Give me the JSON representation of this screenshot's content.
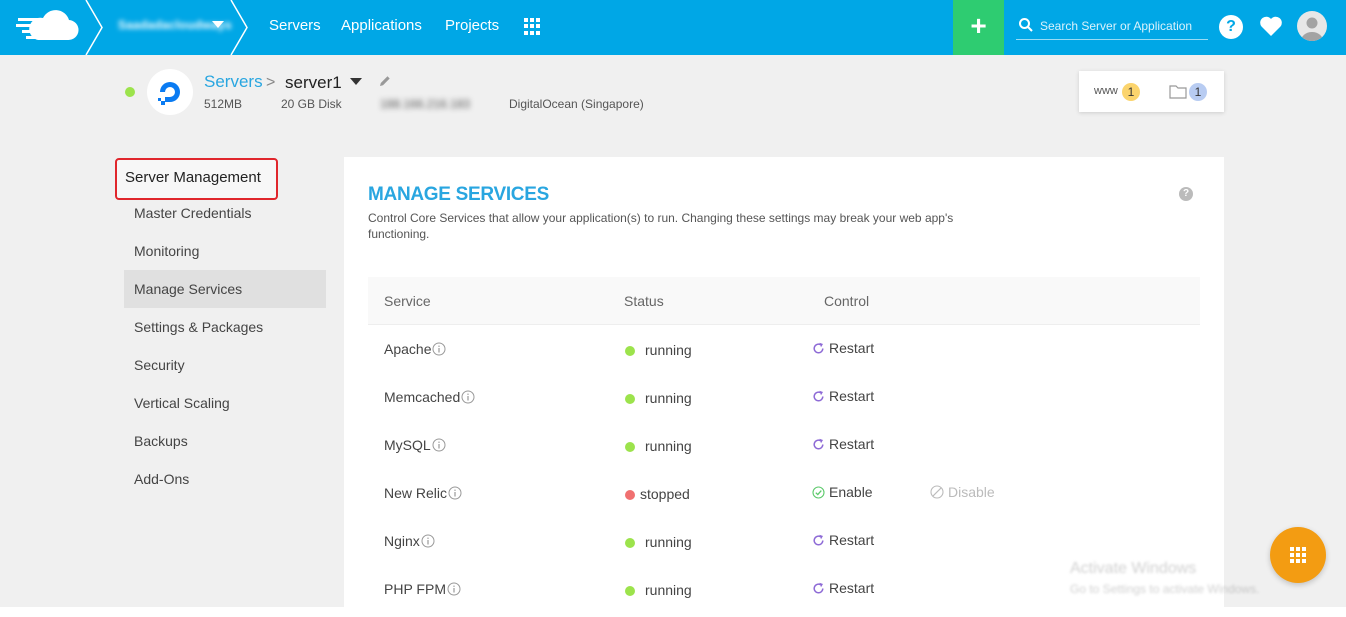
{
  "topbar": {
    "team_name": "Saadadacloudways",
    "nav": [
      "Servers",
      "Applications",
      "Projects"
    ],
    "add_label": "+",
    "search_placeholder": "Search Server or Application",
    "help_label": "?",
    "brand_color": "#00a7e6",
    "add_color": "#2ecc71"
  },
  "server": {
    "breadcrumb_root": "Servers",
    "breadcrumb_sep": ">",
    "name": "server1",
    "ram": "512MB",
    "disk": "20 GB Disk",
    "ip": "188.166.216.183",
    "location": "DigitalOcean (Singapore)",
    "status_color": "#9ce34c",
    "www_label": "www",
    "www_count": "1",
    "folder_count": "1"
  },
  "sidebar": {
    "title": "Server Management",
    "items": [
      {
        "label": "Master Credentials",
        "active": false
      },
      {
        "label": "Monitoring",
        "active": false
      },
      {
        "label": "Manage Services",
        "active": true
      },
      {
        "label": "Settings & Packages",
        "active": false
      },
      {
        "label": "Security",
        "active": false
      },
      {
        "label": "Vertical Scaling",
        "active": false
      },
      {
        "label": "Backups",
        "active": false
      },
      {
        "label": "Add-Ons",
        "active": false
      }
    ]
  },
  "main": {
    "title": "MANAGE SERVICES",
    "description": "Control Core Services that allow your application(s) to run. Changing these settings may break your web app's functioning.",
    "help_label": "?",
    "columns": [
      "Service",
      "Status",
      "Control"
    ],
    "rows": [
      {
        "service": "Apache",
        "status": "running",
        "control": "Restart"
      },
      {
        "service": "Memcached",
        "status": "running",
        "control": "Restart"
      },
      {
        "service": "MySQL",
        "status": "running",
        "control": "Restart"
      },
      {
        "service": "New Relic",
        "status": "stopped",
        "control": "Enable",
        "control2": "Disable"
      },
      {
        "service": "Nginx",
        "status": "running",
        "control": "Restart"
      },
      {
        "service": "PHP FPM",
        "status": "running",
        "control": "Restart"
      }
    ]
  },
  "watermark": {
    "line1": "Activate Windows",
    "line2": "Go to Settings to activate Windows."
  },
  "colors": {
    "accent": "#29a6e0",
    "running": "#9ce34c",
    "stopped": "#f07070",
    "fab": "#f39c12",
    "highlight_border": "#e0262c"
  }
}
